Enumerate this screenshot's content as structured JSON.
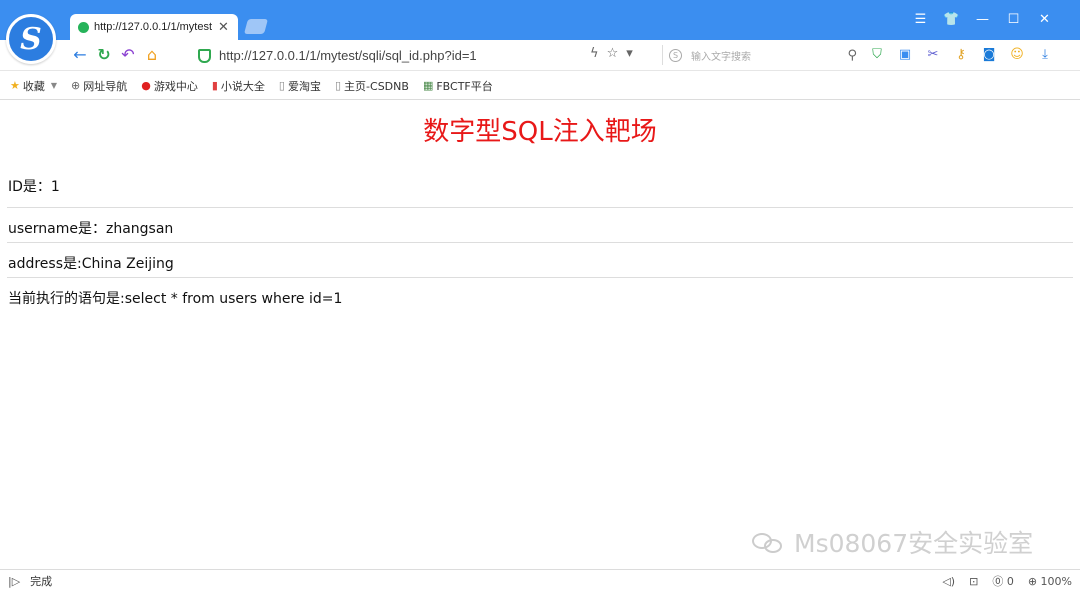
{
  "browser": {
    "tab": {
      "title": "http://127.0.0.1/1/mytest"
    },
    "window_controls": [
      "☰",
      "👕",
      "—",
      "☐",
      "✕"
    ],
    "address": {
      "url": "http://127.0.0.1/1/mytest/sqli/sql_id.php?id=1"
    },
    "search": {
      "placeholder": "输入文字搜索"
    },
    "bookmarks": [
      {
        "label": "收藏",
        "icon": "star-icon"
      },
      {
        "label": "网址导航",
        "icon": "globe-icon"
      },
      {
        "label": "游戏中心",
        "icon": "game-icon"
      },
      {
        "label": "小说大全",
        "icon": "book-icon"
      },
      {
        "label": "爱淘宝",
        "icon": "page-icon"
      },
      {
        "label": "主页-CSDNB",
        "icon": "page-icon"
      },
      {
        "label": "FBCTF平台",
        "icon": "site-icon"
      }
    ],
    "status": {
      "text": "完成",
      "zoom": "100%",
      "blocked_count": "0"
    }
  },
  "page": {
    "title": "数字型SQL注入靶场",
    "id_line": "ID是：1",
    "username_line": "username是：zhangsan",
    "address_line": "address是:China Zeijing",
    "statement_line": "当前执行的语句是:select * from users where id=1"
  },
  "watermark": {
    "text": "Ms08067安全实验室"
  },
  "colors": {
    "titlebar": "#3b8ef0",
    "page_title": "#e81818"
  }
}
